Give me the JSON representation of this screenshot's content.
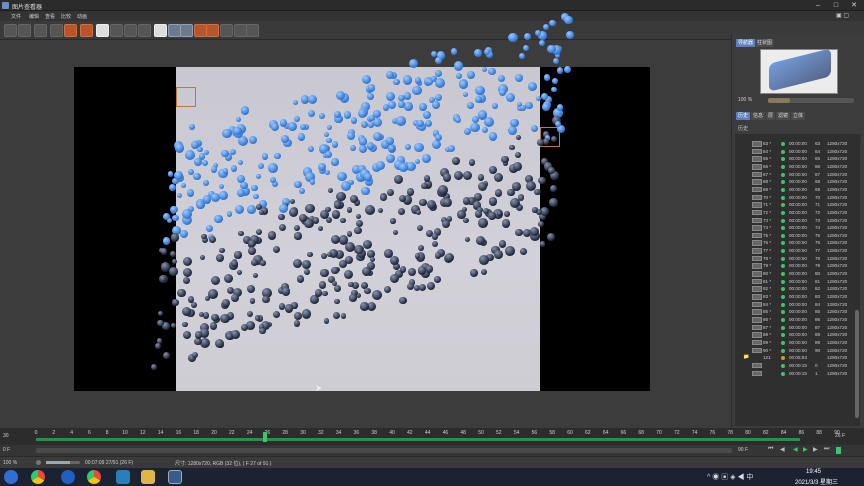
{
  "window": {
    "title": "图片查看器"
  },
  "menu": [
    "文件",
    "编辑",
    "查看",
    "比较",
    "动画"
  ],
  "panel": {
    "tabs": [
      "导航器",
      "柱状图"
    ],
    "zoom": "100 %",
    "tabs2": [
      "历史",
      "信息",
      "层",
      "滤镜",
      "立体"
    ],
    "history_label": "历史",
    "columns": [
      "名称",
      "R",
      "渲染时间",
      "F",
      "分辨率"
    ]
  },
  "history_rows": [
    {
      "name": "63 *",
      "time": "00:00:00",
      "frame": "63",
      "res": "1280x720",
      "status": "done"
    },
    {
      "name": "64 *",
      "time": "00:00:00",
      "frame": "64",
      "res": "1280x720",
      "status": "done"
    },
    {
      "name": "65 *",
      "time": "00:00:00",
      "frame": "65",
      "res": "1280x720",
      "status": "done"
    },
    {
      "name": "66 *",
      "time": "00:00:00",
      "frame": "66",
      "res": "1280x720",
      "status": "done"
    },
    {
      "name": "67 *",
      "time": "00:00:00",
      "frame": "67",
      "res": "1280x720",
      "status": "done"
    },
    {
      "name": "68 *",
      "time": "00:00:00",
      "frame": "68",
      "res": "1280x720",
      "status": "done"
    },
    {
      "name": "69 *",
      "time": "00:00:00",
      "frame": "69",
      "res": "1280x720",
      "status": "done"
    },
    {
      "name": "70 *",
      "time": "00:00:00",
      "frame": "70",
      "res": "1280x720",
      "status": "done"
    },
    {
      "name": "71 *",
      "time": "00:00:00",
      "frame": "71",
      "res": "1280x720",
      "status": "done"
    },
    {
      "name": "72 *",
      "time": "00:00:00",
      "frame": "72",
      "res": "1280x720",
      "status": "done"
    },
    {
      "name": "73 *",
      "time": "00:00:00",
      "frame": "73",
      "res": "1280x720",
      "status": "done"
    },
    {
      "name": "74 *",
      "time": "00:00:00",
      "frame": "74",
      "res": "1280x720",
      "status": "done"
    },
    {
      "name": "75 *",
      "time": "00:00:00",
      "frame": "75",
      "res": "1280x720",
      "status": "done"
    },
    {
      "name": "76 *",
      "time": "00:00:00",
      "frame": "76",
      "res": "1280x720",
      "status": "done"
    },
    {
      "name": "77 *",
      "time": "00:00:00",
      "frame": "77",
      "res": "1280x720",
      "status": "done"
    },
    {
      "name": "78 *",
      "time": "00:00:00",
      "frame": "78",
      "res": "1280x720",
      "status": "done"
    },
    {
      "name": "79 *",
      "time": "00:00:00",
      "frame": "79",
      "res": "1280x720",
      "status": "done"
    },
    {
      "name": "80 *",
      "time": "00:00:00",
      "frame": "80",
      "res": "1280x720",
      "status": "done"
    },
    {
      "name": "81 *",
      "time": "00:00:00",
      "frame": "81",
      "res": "1280x720",
      "status": "done"
    },
    {
      "name": "82 *",
      "time": "00:00:00",
      "frame": "82",
      "res": "1280x720",
      "status": "done"
    },
    {
      "name": "83 *",
      "time": "00:00:00",
      "frame": "83",
      "res": "1280x720",
      "status": "done"
    },
    {
      "name": "84 *",
      "time": "00:00:00",
      "frame": "84",
      "res": "1280x720",
      "status": "done"
    },
    {
      "name": "85 *",
      "time": "00:00:00",
      "frame": "85",
      "res": "1280x720",
      "status": "done"
    },
    {
      "name": "86 *",
      "time": "00:00:00",
      "frame": "86",
      "res": "1280x720",
      "status": "done"
    },
    {
      "name": "87 *",
      "time": "00:00:00",
      "frame": "87",
      "res": "1280x720",
      "status": "done"
    },
    {
      "name": "88 *",
      "time": "00:00:00",
      "frame": "88",
      "res": "1280x720",
      "status": "done"
    },
    {
      "name": "89 *",
      "time": "00:00:00",
      "frame": "89",
      "res": "1280x720",
      "status": "done"
    },
    {
      "name": "90 *",
      "time": "00:00:00",
      "frame": "90",
      "res": "1280x720",
      "status": "done"
    },
    {
      "name": "121",
      "time": "00:06:53",
      "frame": "",
      "res": "1280x720",
      "status": "folder"
    },
    {
      "name": "",
      "time": "00:00:15",
      "frame": "0",
      "res": "1280x720",
      "status": "done"
    },
    {
      "name": "",
      "time": "00:00:15",
      "frame": "1",
      "res": "1280x720",
      "status": "done"
    }
  ],
  "timeline": {
    "start": "30",
    "ticks": [
      "0",
      "2",
      "4",
      "6",
      "8",
      "10",
      "12",
      "14",
      "16",
      "18",
      "20",
      "22",
      "24",
      "26",
      "28",
      "30",
      "32",
      "34",
      "36",
      "38",
      "40",
      "42",
      "44",
      "46",
      "48",
      "50",
      "52",
      "54",
      "56",
      "58",
      "60",
      "62",
      "64",
      "66",
      "68",
      "70",
      "72",
      "74",
      "76",
      "78",
      "80",
      "82",
      "84",
      "86",
      "88",
      "90"
    ],
    "current_frame": "26",
    "end_label": "26 F",
    "left_frame": "0 F",
    "right_frame": "90 F"
  },
  "status": {
    "zoom": "100 %",
    "time": "00:07:09 27/91 (26 F)",
    "info": "尺寸: 1280x720, RGB (32 位), ( F 27 of 91 )"
  },
  "taskbar": {
    "clock": "19:45",
    "date": "2021/3/3 星期三"
  }
}
